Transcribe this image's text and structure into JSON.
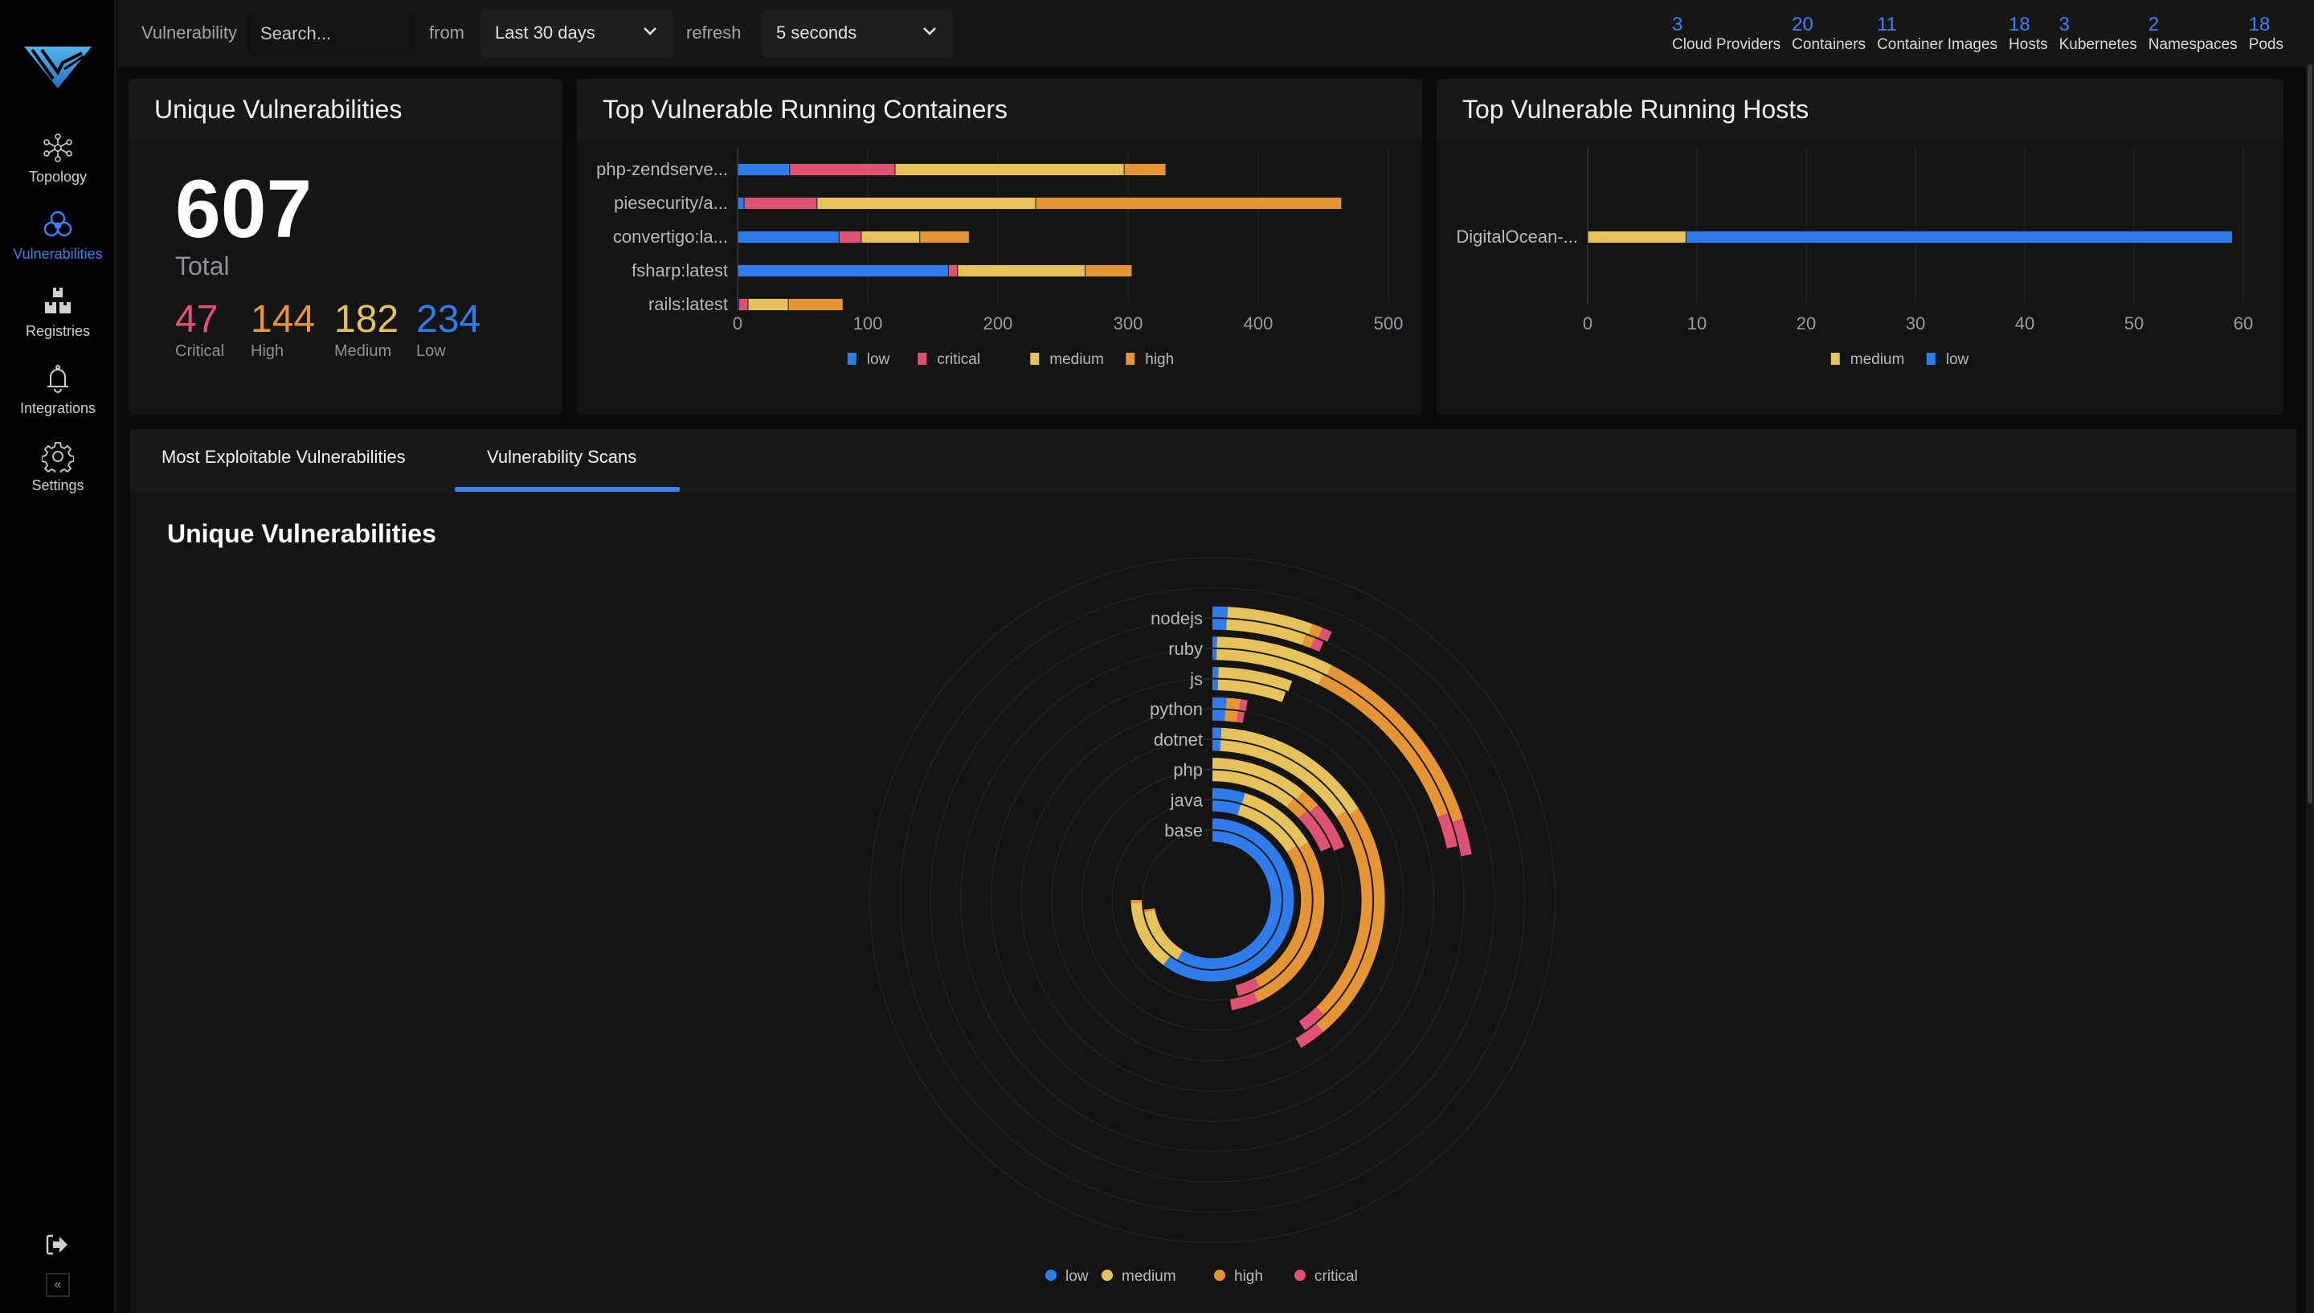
{
  "sidebar": {
    "logo": "deepfence-logo",
    "items": [
      {
        "label": "Topology",
        "icon": "topology-icon",
        "active": false
      },
      {
        "label": "Vulnerabilities",
        "icon": "biohazard-icon",
        "active": true
      },
      {
        "label": "Registries",
        "icon": "registries-icon",
        "active": false
      },
      {
        "label": "Integrations",
        "icon": "bell-icon",
        "active": false
      },
      {
        "label": "Settings",
        "icon": "gear-icon",
        "active": false
      }
    ],
    "logout_icon": "logout-icon",
    "collapse_icon": "«"
  },
  "topbar": {
    "filter_label": "Vulnerability",
    "search_placeholder": "Search...",
    "from_label": "from",
    "range_value": "Last 30 days",
    "refresh_label": "refresh",
    "refresh_value": "5 seconds",
    "stats": [
      {
        "value": "3",
        "label": "Cloud Providers"
      },
      {
        "value": "20",
        "label": "Containers"
      },
      {
        "value": "11",
        "label": "Container Images"
      },
      {
        "value": "18",
        "label": "Hosts"
      },
      {
        "value": "3",
        "label": "Kubernetes"
      },
      {
        "value": "2",
        "label": "Namespaces"
      },
      {
        "value": "18",
        "label": "Pods"
      }
    ]
  },
  "colors": {
    "low": "#2f7ded",
    "medium": "#e6c35a",
    "high": "#e69535",
    "critical": "#e05273",
    "accent": "#3b82f6"
  },
  "unique_card": {
    "title": "Unique Vulnerabilities",
    "total": "607",
    "total_label": "Total",
    "severities": [
      {
        "value": "47",
        "label": "Critical",
        "color": "#e05273"
      },
      {
        "value": "144",
        "label": "High",
        "color": "#e69535"
      },
      {
        "value": "182",
        "label": "Medium",
        "color": "#e6c35a"
      },
      {
        "value": "234",
        "label": "Low",
        "color": "#2f7ded"
      }
    ]
  },
  "containers_card": {
    "title": "Top Vulnerable Running Containers"
  },
  "hosts_card": {
    "title": "Top Vulnerable Running Hosts"
  },
  "tabs": [
    {
      "label": "Most Exploitable Vulnerabilities",
      "active": false
    },
    {
      "label": "Vulnerability Scans",
      "active": true
    }
  ],
  "scans_section": {
    "title": "Unique Vulnerabilities"
  },
  "chart_data": [
    {
      "id": "containers",
      "type": "bar",
      "orientation": "horizontal",
      "stacked": true,
      "title": "Top Vulnerable Running Containers",
      "categories": [
        "php-zendserve...",
        "piesecurity/a...",
        "convertigo:la...",
        "fsharp:latest",
        "rails:latest"
      ],
      "series": [
        {
          "name": "low",
          "values": [
            40,
            5,
            78,
            162,
            1
          ]
        },
        {
          "name": "critical",
          "values": [
            81,
            56,
            17,
            7,
            7
          ]
        },
        {
          "name": "medium",
          "values": [
            176,
            168,
            45,
            98,
            31
          ]
        },
        {
          "name": "high",
          "values": [
            32,
            235,
            38,
            36,
            42
          ]
        }
      ],
      "xlim": [
        0,
        500
      ],
      "xticks": [
        0,
        100,
        200,
        300,
        400,
        500
      ],
      "grid": true,
      "legend": [
        "low",
        "critical",
        "medium",
        "high"
      ],
      "legend_position": "bottom"
    },
    {
      "id": "hosts",
      "type": "bar",
      "orientation": "horizontal",
      "stacked": true,
      "title": "Top Vulnerable Running Hosts",
      "categories": [
        "DigitalOcean-..."
      ],
      "series": [
        {
          "name": "medium",
          "values": [
            9
          ]
        },
        {
          "name": "low",
          "values": [
            50
          ]
        }
      ],
      "xlim": [
        0,
        60
      ],
      "xticks": [
        0,
        10,
        20,
        30,
        40,
        50,
        60
      ],
      "grid": true,
      "legend": [
        "medium",
        "low"
      ],
      "legend_position": "bottom"
    },
    {
      "id": "scans",
      "type": "radial-bar",
      "stacked": true,
      "title": "Unique Vulnerabilities",
      "angle_max": 360,
      "categories": [
        "nodejs",
        "ruby",
        "js",
        "python",
        "dotnet",
        "php",
        "java",
        "base"
      ],
      "series_order": [
        "low",
        "medium",
        "high",
        "critical"
      ],
      "scans": [
        {
          "category": "nodejs",
          "low": 3,
          "medium": 17,
          "high": 2,
          "critical": 2
        },
        {
          "category": "ruby",
          "low": 1,
          "medium": 26,
          "high": 45,
          "critical": 8
        },
        {
          "category": "js",
          "low": 1.5,
          "medium": 18.5,
          "high": 0,
          "critical": 0
        },
        {
          "category": "python",
          "low": 4,
          "medium": 0,
          "high": 4,
          "critical": 2
        },
        {
          "category": "dotnet",
          "low": 3,
          "medium": 55,
          "high": 82,
          "critical": 9
        },
        {
          "category": "php",
          "low": 0,
          "medium": 40,
          "high": 8,
          "critical": 20
        },
        {
          "category": "java",
          "low": 17,
          "medium": 42,
          "high": 97,
          "critical": 14
        },
        {
          "category": "base",
          "low": 217,
          "medium": 51,
          "high": 2,
          "critical": 0
        }
      ],
      "grid": true,
      "legend": [
        "low",
        "medium",
        "high",
        "critical"
      ],
      "legend_position": "bottom"
    }
  ]
}
